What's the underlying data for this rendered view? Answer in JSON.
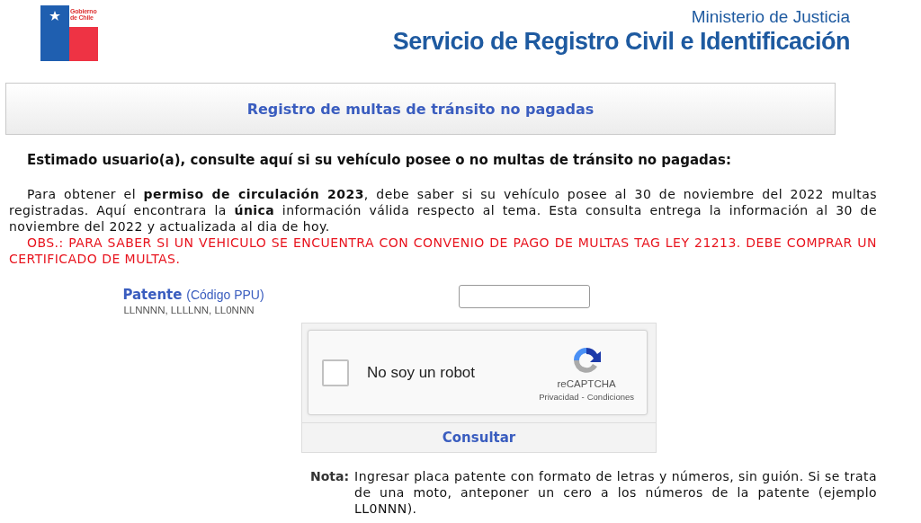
{
  "header": {
    "logo_text": "Gobierno de Chile",
    "ministry": "Ministerio de Justicia",
    "service": "Servicio de Registro Civil e Identificación"
  },
  "title": "Registro de multas de tránsito no pagadas",
  "intro": {
    "heading": "Estimado usuario(a), consulte aquí si su vehículo posee o no multas de tránsito no pagadas:",
    "paragraph": "Para obtener el **permiso de circulación 2023**, debe saber si su vehículo posee al 30 de noviembre del 2022 multas registradas. Aquí encontrara la **única** información válida respecto al tema. Esta consulta entrega la información al 30 de noviembre del 2022 y actualizada al dia de hoy.",
    "notice": "OBS.: PARA SABER SI UN VEHICULO SE ENCUENTRA CON CONVENIO DE PAGO DE MULTAS TAG LEY 21213. DEBE COMPRAR UN CERTIFICADO DE MULTAS."
  },
  "form": {
    "label": "Patente",
    "label_hint": "(Código PPU)",
    "format": "LLNNNN, LLLLNN, LL0NNN"
  },
  "captcha": {
    "checked": false,
    "label": "No soy un robot",
    "brand": "reCAPTCHA",
    "privacy": "Privacidad",
    "separator": "-",
    "terms": "Condiciones"
  },
  "submit": "Consultar",
  "note": {
    "label": "Nota:",
    "text": "Ingresar placa patente con formato de letras y números, sin guión. Si se trata de una moto, anteponer un cero a los números de la patente (ejemplo LL0NNN)."
  }
}
